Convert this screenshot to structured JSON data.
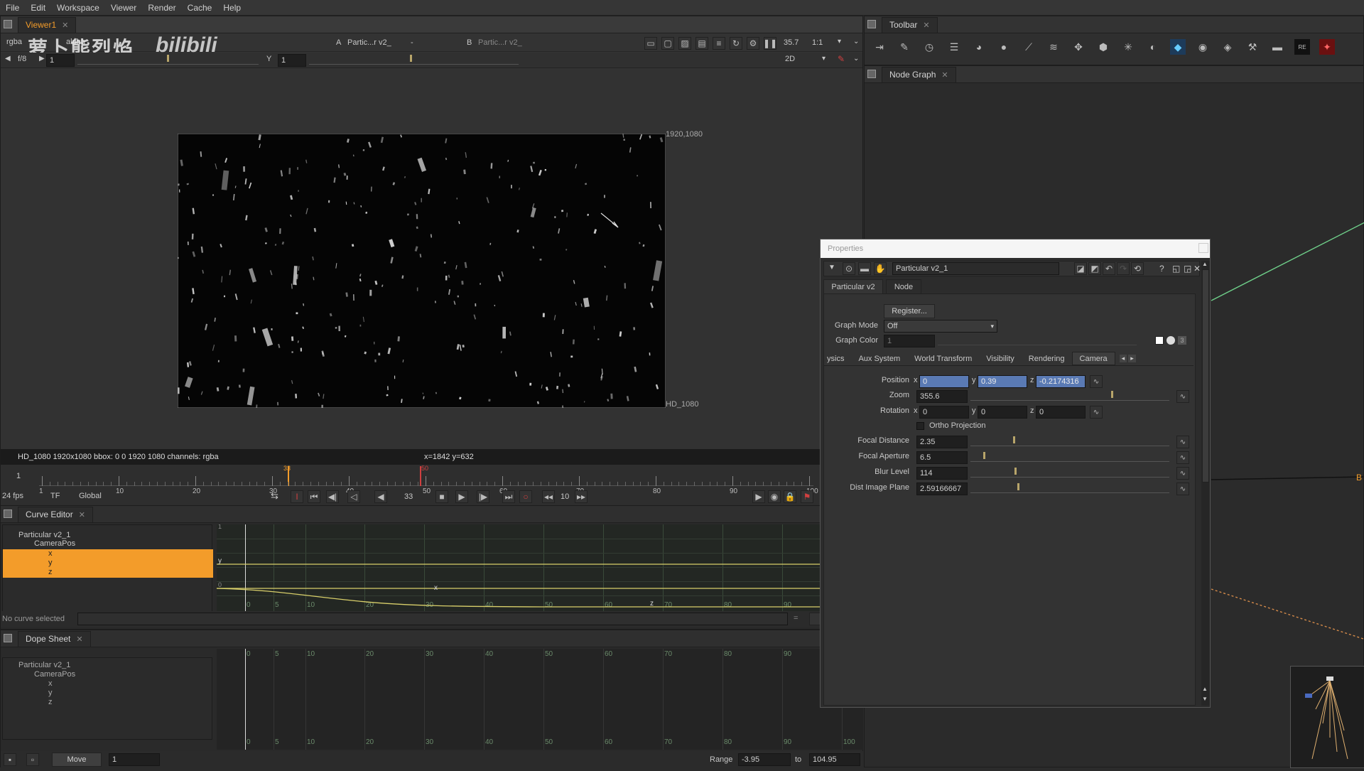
{
  "menu": [
    "File",
    "Edit",
    "Workspace",
    "Viewer",
    "Render",
    "Cache",
    "Help"
  ],
  "viewer": {
    "tab": "Viewer1",
    "channels": "rgba",
    "alpha": "alpha",
    "input_a_label": "A",
    "input_a": "Partic...r v2_",
    "input_dash": "-",
    "input_b_label": "B",
    "input_b": "Partic...r v2_",
    "zoom_value": "35.7",
    "ratio": "1:1",
    "fstop": "f/8",
    "exposure": "1",
    "gamma_label": "Y",
    "gamma": "1",
    "mode_2d": "2D",
    "format_top": "1920,1080",
    "format_bottom": "HD_1080",
    "status": "HD_1080 1920x1080  bbox: 0 0 1920 1080 channels: rgba",
    "coords": "x=1842 y=632",
    "watermark": "萝卜熊烈焰"
  },
  "timeline": {
    "start": "1",
    "ticks": [
      "1",
      "10",
      "20",
      "30",
      "40",
      "50",
      "60",
      "70",
      "80",
      "90",
      "100"
    ],
    "current_marker": "33",
    "key_marker": "50",
    "fps": "24 fps",
    "tf": "TF",
    "global": "Global",
    "frame": "33",
    "step": "10"
  },
  "curve_editor": {
    "tab": "Curve Editor",
    "node": "Particular v2_1",
    "param": "CameraPos",
    "channels": [
      "x",
      "y",
      "z"
    ],
    "status": "No curve selected",
    "eq": "=",
    "ticks": [
      "0",
      "5",
      "10",
      "20",
      "30",
      "40",
      "50",
      "60",
      "70",
      "80",
      "90"
    ],
    "label_y": "y",
    "label_x": "x",
    "label_z": "z",
    "label_0": "0",
    "label_1": "1"
  },
  "dope_sheet": {
    "tab": "Dope Sheet",
    "node": "Particular v2_1",
    "param": "CameraPos",
    "channels": [
      "x",
      "y",
      "z"
    ],
    "ticks": [
      "0",
      "5",
      "10",
      "20",
      "30",
      "40",
      "50",
      "60",
      "70",
      "80",
      "90",
      "100"
    ],
    "move": "Move",
    "move_value": "1",
    "range_label": "Range",
    "range_from": "-3.95",
    "to_label": "to",
    "range_to": "104.95"
  },
  "toolbar_tab": "Toolbar",
  "node_graph_tab": "Node Graph",
  "node_graph_label": "B",
  "properties": {
    "title": "Properties",
    "node_name": "Particular v2_1",
    "tabs": [
      "Particular v2",
      "Node"
    ],
    "register": "Register...",
    "graph_mode_label": "Graph Mode",
    "graph_mode": "Off",
    "graph_color_label": "Graph Color",
    "graph_color": "1",
    "subtabs": [
      "ysics",
      "Aux System",
      "World Transform",
      "Visibility",
      "Rendering",
      "Camera"
    ],
    "position_label": "Position",
    "pos_x": "0",
    "pos_y": "0.39",
    "pos_z": "-0.2174316",
    "zoom_label": "Zoom",
    "zoom": "355.6",
    "rotation_label": "Rotation",
    "rot_x": "0",
    "rot_y": "0",
    "rot_z": "0",
    "ortho_label": "Ortho Projection",
    "focal_distance_label": "Focal Distance",
    "focal_distance": "2.35",
    "focal_aperture_label": "Focal Aperture",
    "focal_aperture": "6.5",
    "blur_level_label": "Blur Level",
    "blur_level": "114",
    "dist_image_plane_label": "Dist Image Plane",
    "dist_image_plane": "2.59166667",
    "axis_x": "x",
    "axis_y": "y",
    "axis_z": "z"
  },
  "colors": {
    "accent": "#f39c2a",
    "curve": "#d8cf6a",
    "selection": "#5a7ab4"
  }
}
